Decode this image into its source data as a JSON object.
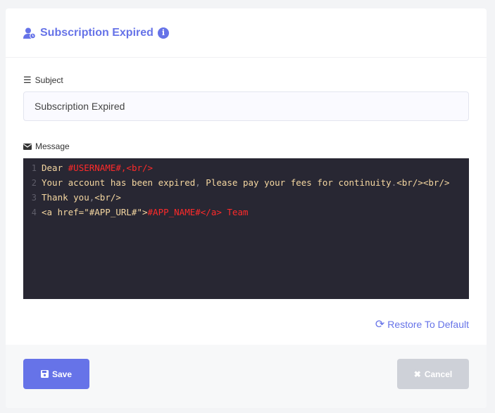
{
  "header": {
    "title": "Subscription Expired"
  },
  "subject": {
    "label": "Subject",
    "value": "Subscription Expired"
  },
  "message": {
    "label": "Message",
    "lines": [
      {
        "num": "1",
        "tokens": [
          {
            "c": "t",
            "s": "Dear "
          },
          {
            "c": "r",
            "s": "#USERNAME#,<br/>"
          }
        ]
      },
      {
        "num": "2",
        "tokens": [
          {
            "c": "t",
            "s": "Your account has been expired"
          },
          {
            "c": "p",
            "s": ","
          },
          {
            "c": "t",
            "s": " Please pay your fees for continuity"
          },
          {
            "c": "p",
            "s": "."
          },
          {
            "c": "t",
            "s": "<br/><br/>"
          }
        ]
      },
      {
        "num": "3",
        "tokens": [
          {
            "c": "t",
            "s": "Thank you"
          },
          {
            "c": "p",
            "s": ","
          },
          {
            "c": "t",
            "s": "<br/>"
          }
        ]
      },
      {
        "num": "4",
        "tokens": [
          {
            "c": "t",
            "s": "<a href=\"#APP_URL#\">"
          },
          {
            "c": "r",
            "s": "#APP_NAME#</a> Team"
          }
        ]
      }
    ]
  },
  "restore_label": "Restore To Default",
  "footer": {
    "save_label": "Save",
    "cancel_label": "Cancel"
  }
}
